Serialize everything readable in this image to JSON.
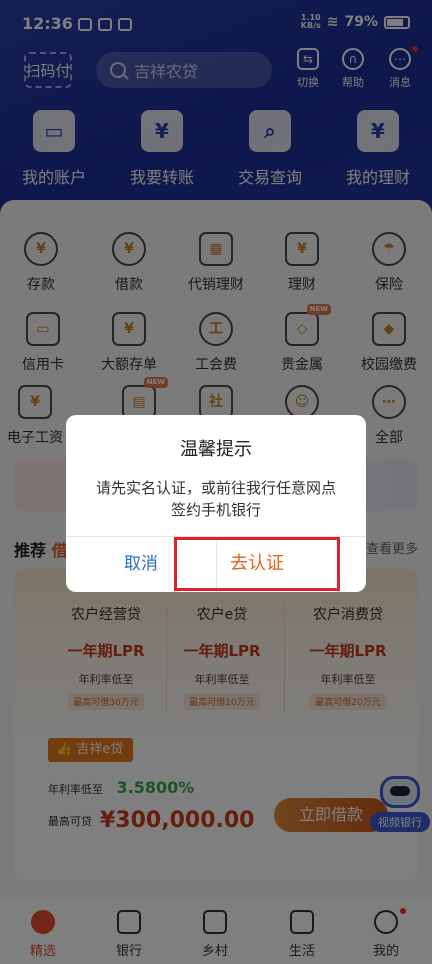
{
  "status": {
    "time": "12:36",
    "net_speed_top": "1.10",
    "net_speed_bottom": "KB/s",
    "battery": "79%"
  },
  "topbar": {
    "scan_label": "扫码付",
    "search_placeholder": "吉祥农贷",
    "actions": [
      {
        "label": "切换",
        "icon": "switch-icon"
      },
      {
        "label": "帮助",
        "icon": "headset-icon"
      },
      {
        "label": "消息",
        "icon": "message-icon"
      }
    ]
  },
  "quick": [
    {
      "label": "我的账户",
      "glyph": "▭"
    },
    {
      "label": "我要转账",
      "glyph": "¥"
    },
    {
      "label": "交易查询",
      "glyph": "⌕"
    },
    {
      "label": "我的理财",
      "glyph": "¥"
    }
  ],
  "services": [
    {
      "label": "存款",
      "glyph": "¥"
    },
    {
      "label": "借款",
      "glyph": "¥"
    },
    {
      "label": "代销理财",
      "glyph": "▦"
    },
    {
      "label": "理财",
      "glyph": "¥"
    },
    {
      "label": "保险",
      "glyph": "☂"
    },
    {
      "label": "信用卡",
      "glyph": "▭"
    },
    {
      "label": "大额存单",
      "glyph": "¥"
    },
    {
      "label": "工会费",
      "glyph": "工"
    },
    {
      "label": "贵金属",
      "glyph": "◇",
      "badge": "NEW"
    },
    {
      "label": "校园缴费",
      "glyph": "◆"
    },
    {
      "label": "电子工资",
      "glyph": "¥"
    },
    {
      "label": "",
      "glyph": "▤",
      "badge": "NEW"
    },
    {
      "label": "",
      "glyph": "社"
    },
    {
      "label": "",
      "glyph": "☺"
    },
    {
      "label": "全部",
      "glyph": "⋯"
    }
  ],
  "recommend": {
    "title_prefix": "推荐",
    "title_highlight": "借",
    "more": "查看更多"
  },
  "loans": [
    {
      "name": "农户经营贷",
      "lpr": "一年期LPR",
      "low": "年利率低至",
      "max": "最高可借30万元"
    },
    {
      "name": "农户e贷",
      "lpr": "一年期LPR",
      "low": "年利率低至",
      "max": "最高可借10万元"
    },
    {
      "name": "农户消费贷",
      "lpr": "一年期LPR",
      "low": "年利率低至",
      "max": "最高可借20万元"
    }
  ],
  "featured": {
    "tag": "吉祥e贷",
    "rate_label": "年利率低至",
    "rate": "3.5800%",
    "amount_label": "最高可贷",
    "amount": "¥300,000.00",
    "button": "立即借款",
    "video_label": "视频银行"
  },
  "bottom_nav": [
    {
      "label": "精选",
      "active": true
    },
    {
      "label": "银行"
    },
    {
      "label": "乡村"
    },
    {
      "label": "生活"
    },
    {
      "label": "我的"
    }
  ],
  "dialog": {
    "title": "温馨提示",
    "message": "请先实名认证，或前往我行任意网点签约手机银行",
    "cancel": "取消",
    "confirm": "去认证"
  }
}
